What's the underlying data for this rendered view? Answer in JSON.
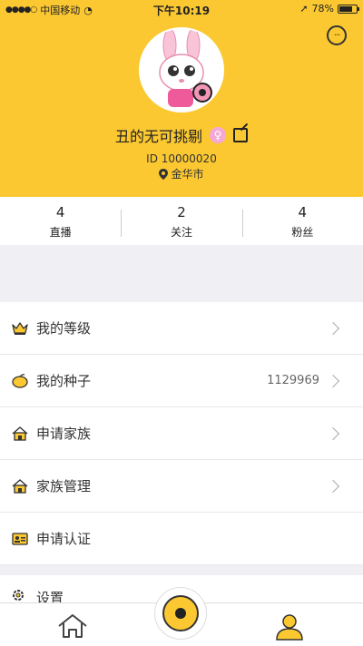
{
  "statusbar": {
    "carrier": "中国移动",
    "time": "下午10:19",
    "battery": "78%",
    "battery_level": 0.78
  },
  "profile": {
    "name": "丑的无可挑剔",
    "gender_symbol": "♀",
    "id_text": "ID 10000020",
    "location": "金华市"
  },
  "stats": [
    {
      "value": "4",
      "label": "直播"
    },
    {
      "value": "2",
      "label": "关注"
    },
    {
      "value": "4",
      "label": "粉丝"
    }
  ],
  "menu": [
    {
      "label": "我的等级",
      "value": ""
    },
    {
      "label": "我的种子",
      "value": "1129969"
    },
    {
      "label": "申请家族",
      "value": ""
    },
    {
      "label": "家族管理",
      "value": ""
    },
    {
      "label": "申请认证",
      "value": ""
    }
  ],
  "settings_label": "设置",
  "colors": {
    "accent": "#fbc832",
    "gender": "#f4a8d6"
  }
}
